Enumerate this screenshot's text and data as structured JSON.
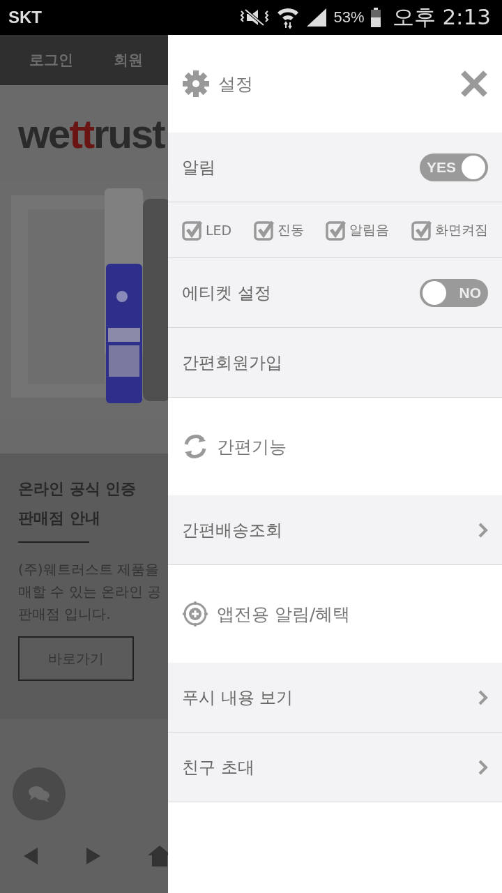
{
  "status_bar": {
    "carrier": "SKT",
    "battery": "53%",
    "time": "오후 2:13"
  },
  "page": {
    "nav": [
      "로그인",
      "회원"
    ],
    "logo": {
      "before": "we",
      "accent": "tt",
      "after": "rust"
    },
    "notice": {
      "title_lines": [
        "온라인 공식 인증",
        "판매점 안내"
      ],
      "body_lines": [
        "(주)웨트러스트 제품을",
        "매할 수 있는 온라인 공",
        "판매점 입니다."
      ],
      "button": "바로가기"
    }
  },
  "drawer": {
    "title": "설정",
    "items": [
      {
        "kind": "toggle",
        "label": "알림",
        "on": true,
        "text": "YES"
      },
      {
        "kind": "checks",
        "options": [
          {
            "label": "LED",
            "checked": true
          },
          {
            "label": "진동",
            "checked": true
          },
          {
            "label": "알림음",
            "checked": true
          },
          {
            "label": "화면켜짐",
            "checked": true
          }
        ]
      },
      {
        "kind": "toggle",
        "label": "에티켓 설정",
        "on": false,
        "text": "NO"
      },
      {
        "kind": "link",
        "label": "간편회원가입",
        "chevron": false
      },
      {
        "kind": "header",
        "label": "간편기능"
      },
      {
        "kind": "link",
        "label": "간편배송조회",
        "chevron": true
      },
      {
        "kind": "header",
        "label": "앱전용 알림/혜택"
      },
      {
        "kind": "link",
        "label": "푸시 내용 보기",
        "chevron": true
      },
      {
        "kind": "link",
        "label": "친구 초대",
        "chevron": true
      }
    ]
  }
}
